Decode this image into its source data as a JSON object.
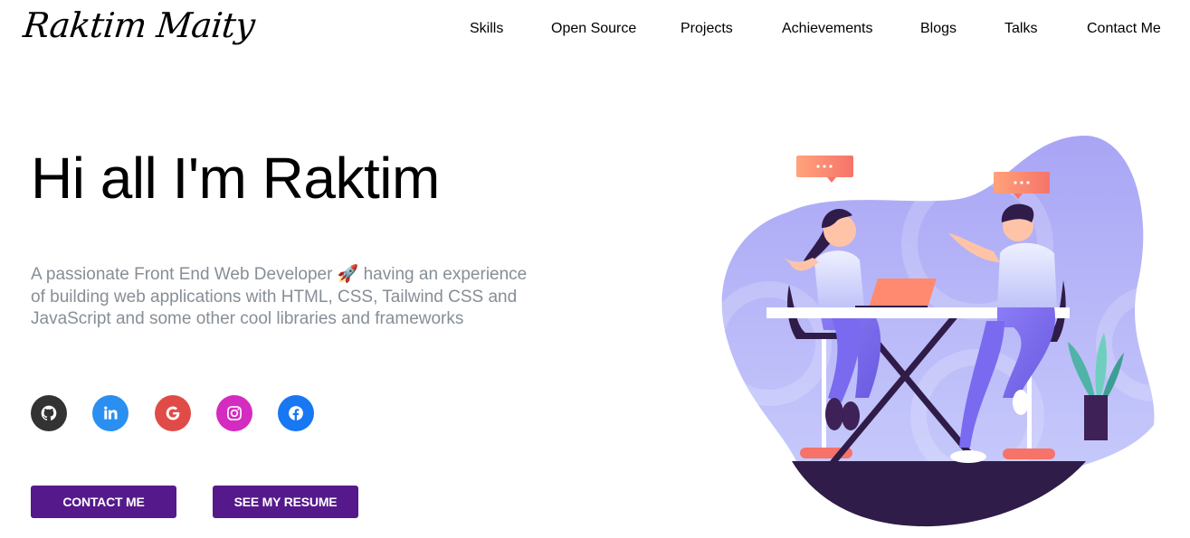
{
  "header": {
    "logo": "Raktim Maity",
    "nav": [
      {
        "label": "Skills"
      },
      {
        "label": "Open Source"
      },
      {
        "label": "Projects"
      },
      {
        "label": "Achievements"
      },
      {
        "label": "Blogs"
      },
      {
        "label": "Talks"
      },
      {
        "label": "Contact Me"
      }
    ]
  },
  "hero": {
    "title": "Hi all I'm Raktim",
    "description": "A passionate Front End Web Developer 🚀 having an experience of building web applications with HTML, CSS, Tailwind CSS and JavaScript and some other cool libraries and frameworks"
  },
  "social": [
    {
      "icon": "github-icon",
      "color": "#333333"
    },
    {
      "icon": "linkedin-icon",
      "color": "#0e76a8"
    },
    {
      "icon": "google-icon",
      "color": "#ea4335"
    },
    {
      "icon": "instagram-icon",
      "color": "#c13584"
    },
    {
      "icon": "facebook-icon",
      "color": "#3b5998"
    }
  ],
  "buttons": {
    "contact": "CONTACT ME",
    "resume": "SEE MY RESUME"
  },
  "colors": {
    "accent": "#55198b",
    "text_secondary": "#868e96",
    "blob": "#b2b4f7"
  }
}
